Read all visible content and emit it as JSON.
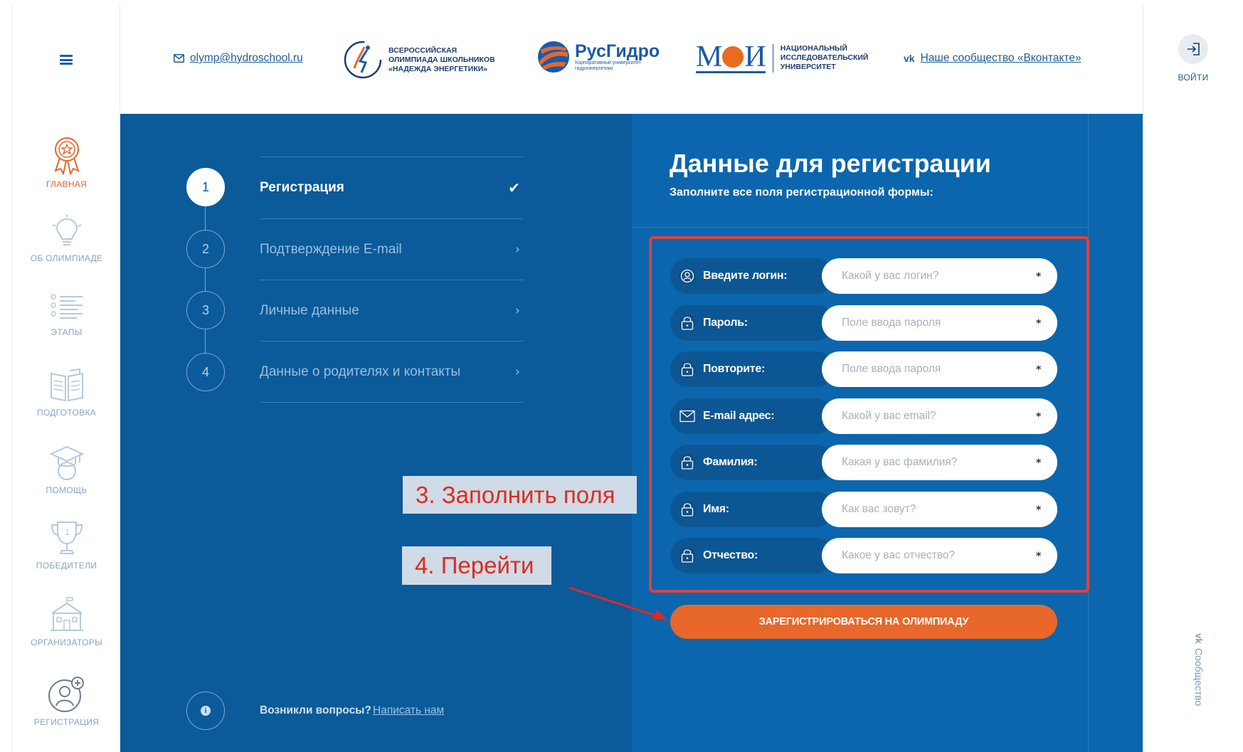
{
  "header": {
    "email": "olymp@hydroschool.ru",
    "logo1_lines": [
      "ВСЕРОССИЙСКАЯ",
      "ОЛИМПИАДА ШКОЛЬНИКОВ",
      "«НАДЕЖДА ЭНЕРГЕТИКИ»"
    ],
    "logo2_title": "РусГидро",
    "logo2_sub_lines": [
      "Корпоративный университет",
      "гидроэнергетики"
    ],
    "logo3_mark": "МЭИ",
    "logo3_lines": [
      "НАЦИОНАЛЬНЫЙ",
      "ИССЛЕДОВАТЕЛЬСКИЙ",
      "УНИВЕРСИТЕТ"
    ],
    "vk_link": "Наше сообщество «Вконтакте»",
    "login_label": "ВОЙТИ"
  },
  "sidenav": [
    {
      "label": "ГЛАВНАЯ",
      "icon": "award-icon",
      "active": true
    },
    {
      "label": "ОБ ОЛИМПИАДЕ",
      "icon": "lightbulb-icon",
      "active": false
    },
    {
      "label": "ЭТАПЫ",
      "icon": "list-icon",
      "active": false
    },
    {
      "label": "ПОДГОТОВКА",
      "icon": "book-icon",
      "active": false
    },
    {
      "label": "ПОМОЩЬ",
      "icon": "graduation-cap-icon",
      "active": false
    },
    {
      "label": "ПОБЕДИТЕЛИ",
      "icon": "trophy-icon",
      "active": false
    },
    {
      "label": "ОРГАНИЗАТОРЫ",
      "icon": "building-icon",
      "active": false
    },
    {
      "label": "РЕГИСТРАЦИЯ",
      "icon": "user-add-icon",
      "active": false
    }
  ],
  "steps": [
    {
      "num": "1",
      "label": "Регистрация",
      "active": true
    },
    {
      "num": "2",
      "label": "Подтверждение E-mail",
      "active": false
    },
    {
      "num": "3",
      "label": "Личные данные",
      "active": false
    },
    {
      "num": "4",
      "label": "Данные о родителях и контакты",
      "active": false
    }
  ],
  "help": {
    "question": "Возникли вопросы?",
    "link": "Написать нам"
  },
  "form": {
    "title": "Данные для регистрации",
    "subtitle": "Заполните все поля регистрационной формы:",
    "fields": [
      {
        "label": "Введите логин:",
        "placeholder": "Какой у вас логин?",
        "icon": "user-icon",
        "required": "*"
      },
      {
        "label": "Пароль:",
        "placeholder": "Поле ввода пароля",
        "icon": "lock-icon",
        "required": "*"
      },
      {
        "label": "Повторите:",
        "placeholder": "Поле ввода пароля",
        "icon": "lock-icon",
        "required": "*"
      },
      {
        "label": "E-mail адрес:",
        "placeholder": "Какой у вас email?",
        "icon": "envelope-icon",
        "required": "*"
      },
      {
        "label": "Фамилия:",
        "placeholder": "Какая у вас фамилия?",
        "icon": "lock-icon",
        "required": "*"
      },
      {
        "label": "Имя:",
        "placeholder": "Как вас зовут?",
        "icon": "lock-icon",
        "required": "*"
      },
      {
        "label": "Отчество:",
        "placeholder": "Какое у вас отчество?",
        "icon": "lock-icon",
        "required": "*"
      }
    ],
    "submit_label": "ЗАРЕГИСТРИРОВАТЬСЯ НА ОЛИМПИАДУ"
  },
  "annotations": {
    "fill": "3. Заполнить поля",
    "go": "4. Перейти"
  },
  "side_vk": "Сообщество",
  "colors": {
    "accent": "#e8672a",
    "blue_dark": "#0b5a9a",
    "blue": "#0b66ad",
    "annotation_red": "#e02a1f"
  }
}
